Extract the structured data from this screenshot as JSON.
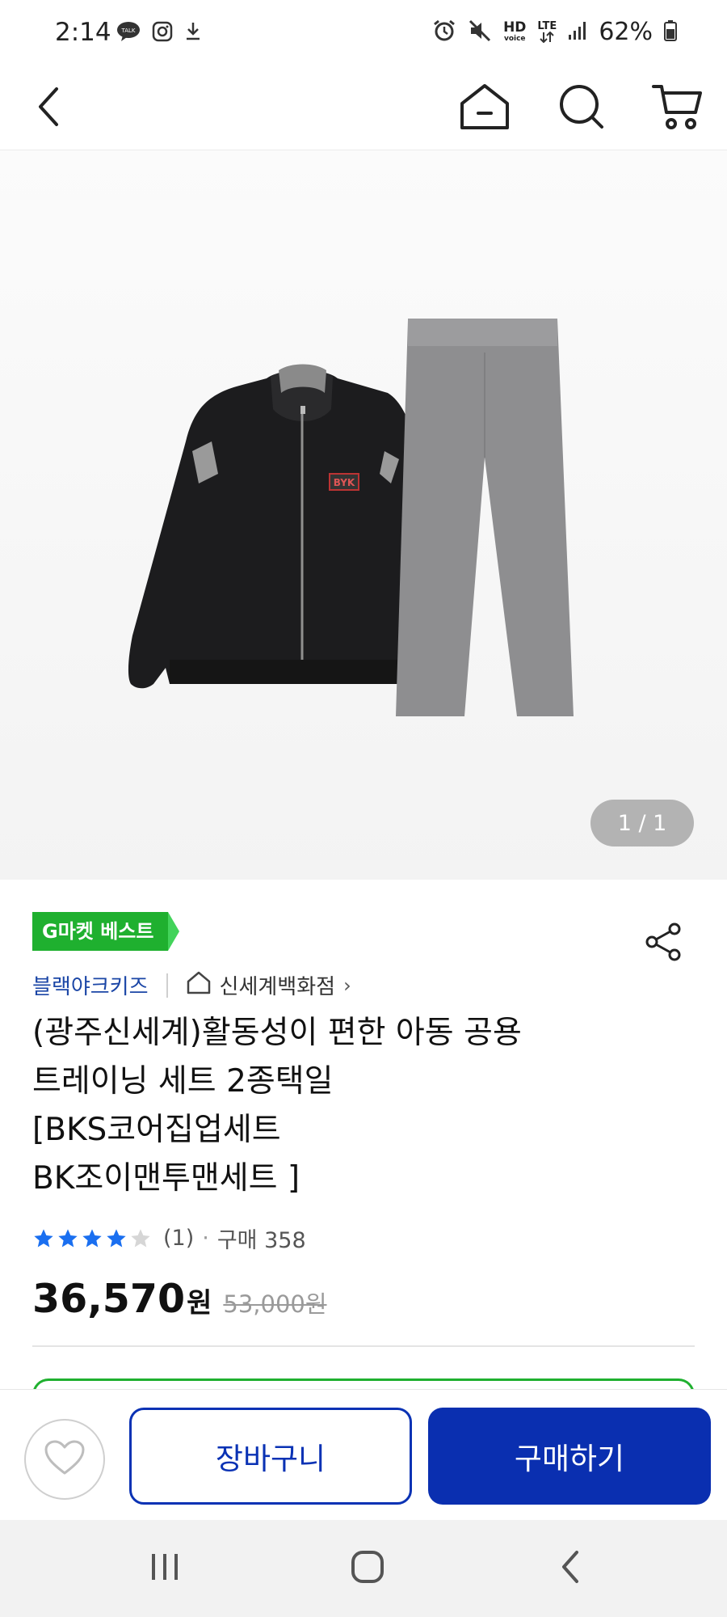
{
  "status_bar": {
    "time": "2:14",
    "left_icons": [
      "talk-icon",
      "instagram-icon",
      "download-icon"
    ],
    "right_icons": [
      "alarm-icon",
      "mute-icon",
      "hd-voice-icon",
      "lte-icon",
      "signal-icon"
    ],
    "hd_label": "HD",
    "voice_label": "voice",
    "lte_label": "LTE",
    "battery_percent": "62%"
  },
  "top_nav": {
    "icons": [
      "back-icon",
      "home-icon",
      "search-icon",
      "cart-icon"
    ]
  },
  "gallery": {
    "pager": "1 / 1"
  },
  "product": {
    "badge": "G마켓 베스트",
    "brand": "블랙야크키즈",
    "store": "신세계백화점",
    "store_chevron": "›",
    "title": "(광주신세계)활동성이 편한 아동 공용\n트레이닝 세트 2종택일\n[BKS코어집업세트\nBK조이맨투맨세트 ]",
    "rating_stars": 4,
    "rating_max": 5,
    "review_count": "(1)",
    "dot": "·",
    "purchase_count": "구매 358",
    "price": "36,570",
    "price_unit": "원",
    "original_price": "53,000원"
  },
  "actions": {
    "cart_label": "장바구니",
    "buy_label": "구매하기"
  },
  "system_nav": {
    "icons": [
      "recents-icon",
      "home-button-icon",
      "back-button-icon"
    ]
  },
  "colors": {
    "accent_blue": "#0a2fb0",
    "badge_green": "#1fb02f",
    "star_blue": "#1a6ff0"
  }
}
